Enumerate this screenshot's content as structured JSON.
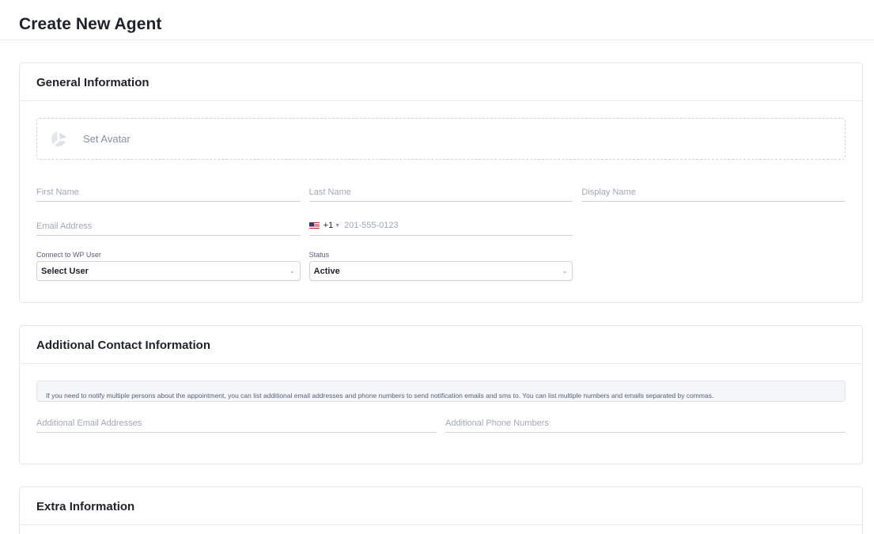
{
  "page": {
    "title": "Create New Agent"
  },
  "general": {
    "title": "General Information",
    "avatar_label": "Set Avatar",
    "first_name_label": "First Name",
    "last_name_label": "Last Name",
    "display_name_label": "Display Name",
    "email_label": "Email Address",
    "phone": {
      "country_code": "+1",
      "placeholder": "201-555-0123"
    },
    "wp_user": {
      "label": "Connect to WP User",
      "value": "Select User"
    },
    "status": {
      "label": "Status",
      "value": "Active"
    }
  },
  "additional": {
    "title": "Additional Contact Information",
    "notice": "If you need to notify multiple persons about the appointment, you can list additional email addresses and phone numbers to send notification emails and sms to. You can list multiple numbers and emails separated by commas.",
    "emails_label": "Additional Email Addresses",
    "phones_label": "Additional Phone Numbers"
  },
  "extra": {
    "title": "Extra Information"
  },
  "icons": {
    "avatar": "avatar-placeholder-icon",
    "flag": "us-flag-icon",
    "dropdown": "chevron-down-icon"
  },
  "colors": {
    "label": "#a0a8b8",
    "border": "#e3e7ed",
    "text": "#1f222b"
  }
}
